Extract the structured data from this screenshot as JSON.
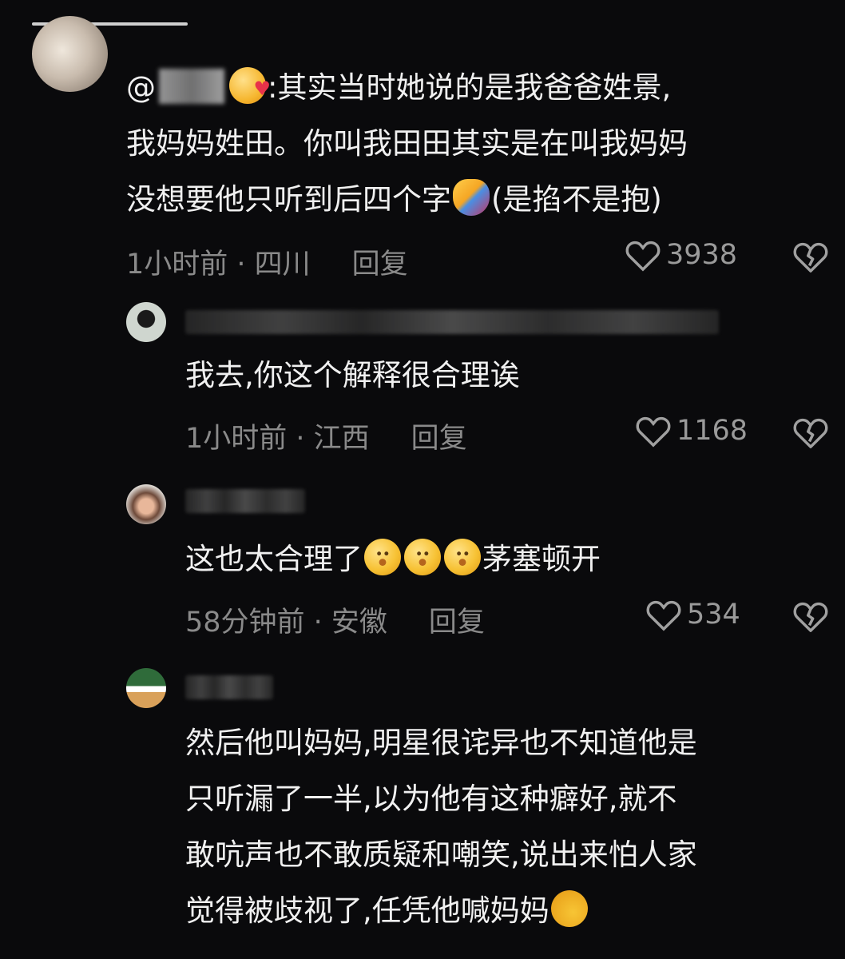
{
  "comments": [
    {
      "lines": [
        "其实当时她说的是我爸爸姓景,",
        "我妈妈姓田。你叫我田田其实是在叫我妈妈",
        "没想要他只听到后四个字",
        "(是掐不是抱)"
      ],
      "mention_prefix": "@",
      "mention_suffix": ":",
      "time_location": "1小时前 · 四川",
      "reply_label": "回复",
      "likes": "3938"
    },
    {
      "text": "我去,你这个解释很合理诶",
      "time_location": "1小时前 · 江西",
      "reply_label": "回复",
      "likes": "1168"
    },
    {
      "text_before": "这也太合理了",
      "text_after": "茅塞顿开",
      "time_location": "58分钟前 · 安徽",
      "reply_label": "回复",
      "likes": "534"
    },
    {
      "lines": [
        "然后他叫妈妈,明星很诧异也不知道他是",
        "只听漏了一半,以为他有这种癖好,就不",
        "敢吭声也不敢质疑和嘲笑,说出来怕人家",
        "觉得被歧视了,任凭他喊妈妈"
      ]
    }
  ],
  "icons": {
    "like": "heart-outline-icon",
    "dislike": "broken-heart-icon"
  },
  "colors": {
    "background": "#0a0a0c",
    "text": "#f0f0f0",
    "meta": "#8a8a8a"
  }
}
